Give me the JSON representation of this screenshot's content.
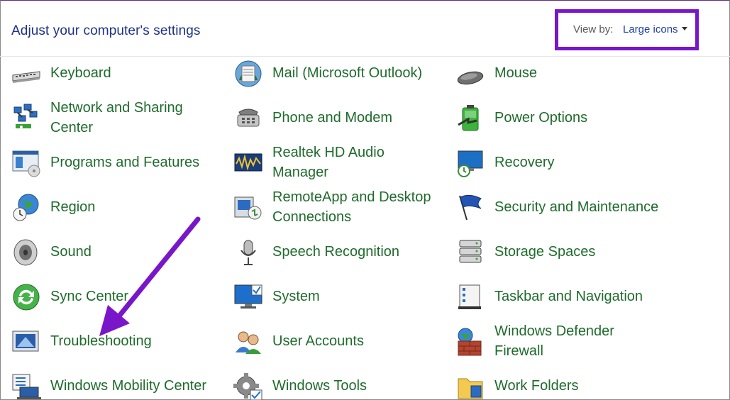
{
  "header": {
    "title": "Adjust your computer's settings",
    "view_by_label": "View by:",
    "view_by_value": "Large icons"
  },
  "items": [
    {
      "label": "Keyboard",
      "icon": "keyboard-icon"
    },
    {
      "label": "Mail (Microsoft Outlook)",
      "icon": "mail-icon"
    },
    {
      "label": "Mouse",
      "icon": "mouse-icon"
    },
    {
      "label": "Network and Sharing",
      "label2": "Center",
      "icon": "network-icon"
    },
    {
      "label": "Phone and Modem",
      "icon": "phone-icon"
    },
    {
      "label": "Power Options",
      "icon": "battery-icon"
    },
    {
      "label": "Programs and Features",
      "icon": "programs-icon"
    },
    {
      "label": "Realtek HD Audio",
      "label2": "Manager",
      "icon": "audio-manager-icon"
    },
    {
      "label": "Recovery",
      "icon": "recovery-icon"
    },
    {
      "label": "Region",
      "icon": "globe-clock-icon"
    },
    {
      "label": "RemoteApp and Desktop",
      "label2": "Connections",
      "icon": "remote-desktop-icon"
    },
    {
      "label": "Security and Maintenance",
      "icon": "flag-icon"
    },
    {
      "label": "Sound",
      "icon": "speaker-icon"
    },
    {
      "label": "Speech Recognition",
      "icon": "microphone-icon"
    },
    {
      "label": "Storage Spaces",
      "icon": "storage-icon"
    },
    {
      "label": "Sync Center",
      "icon": "sync-icon"
    },
    {
      "label": "System",
      "icon": "monitor-check-icon"
    },
    {
      "label": "Taskbar and Navigation",
      "icon": "taskbar-icon"
    },
    {
      "label": "Troubleshooting",
      "icon": "troubleshoot-monitor-icon"
    },
    {
      "label": "User Accounts",
      "icon": "users-icon"
    },
    {
      "label": "Windows Defender",
      "label2": "Firewall",
      "icon": "firewall-icon"
    },
    {
      "label": "Windows Mobility Center",
      "icon": "mobility-icon"
    },
    {
      "label": "Windows Tools",
      "icon": "gear-tools-icon"
    },
    {
      "label": "Work Folders",
      "icon": "folder-icon"
    }
  ],
  "colors": {
    "title": "#1e3287",
    "link": "#1f6b2c",
    "highlight": "#7a16c9"
  }
}
